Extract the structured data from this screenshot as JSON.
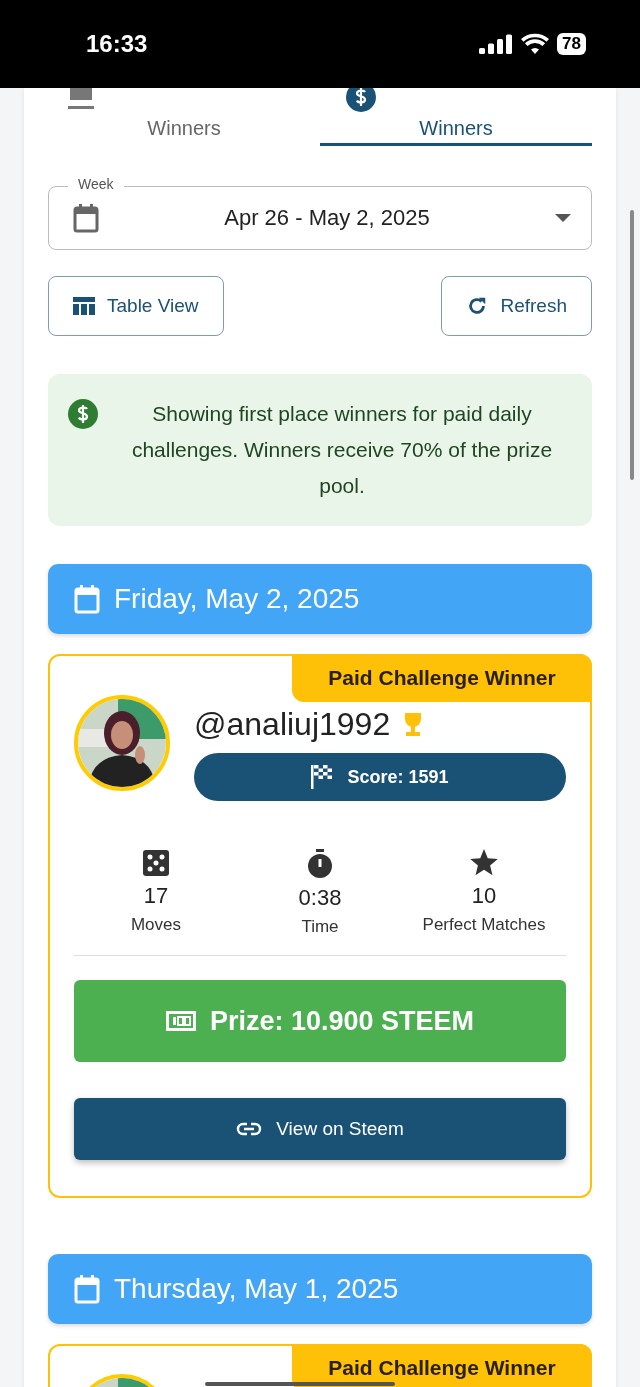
{
  "status_bar": {
    "time": "16:33",
    "battery": "78"
  },
  "tabs": [
    {
      "label": "Winners",
      "selected": false
    },
    {
      "label": "Winners",
      "selected": true
    }
  ],
  "week_field": {
    "label": "Week",
    "value": "Apr 26 - May 2, 2025"
  },
  "actions": [
    {
      "kind": "table",
      "label": "Table View"
    },
    {
      "kind": "refresh",
      "label": "Refresh"
    }
  ],
  "info": "Showing first place winners for paid daily challenges. Winners receive 70% of the prize pool.",
  "days": [
    {
      "date": "Friday, May 2, 2025",
      "winner": {
        "badge": "Paid Challenge Winner",
        "username": "@analiuj1992",
        "score": "Score: 1591",
        "stats": [
          {
            "kind": "moves",
            "value": "17",
            "label": "Moves"
          },
          {
            "kind": "time",
            "value": "0:38",
            "label": "Time"
          },
          {
            "kind": "perfect",
            "value": "10",
            "label": "Perfect Matches"
          }
        ],
        "prize": "Prize: 10.900 STEEM",
        "link": "View on Steem"
      }
    },
    {
      "date": "Thursday, May 1, 2025",
      "winner": {
        "badge": "Paid Challenge Winner"
      }
    }
  ]
}
